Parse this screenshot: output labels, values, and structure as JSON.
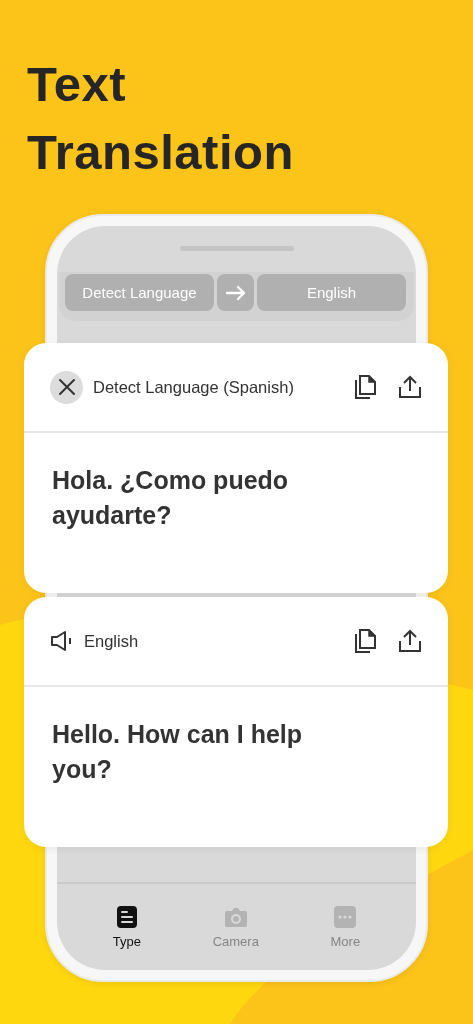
{
  "headline": "Text Translation",
  "language_bar": {
    "source": "Detect Language",
    "target": "English"
  },
  "cards": [
    {
      "kind": "source",
      "language": "Detect Language (Spanish)",
      "text": "Hola. ¿Como puedo ayudarte?"
    },
    {
      "kind": "target",
      "language": "English",
      "text": "Hello. How can I help you?"
    }
  ],
  "tabs": [
    {
      "kind": "type",
      "label": "Type",
      "selected": true
    },
    {
      "kind": "camera",
      "label": "Camera",
      "selected": false
    },
    {
      "kind": "more",
      "label": "More",
      "selected": false
    }
  ]
}
